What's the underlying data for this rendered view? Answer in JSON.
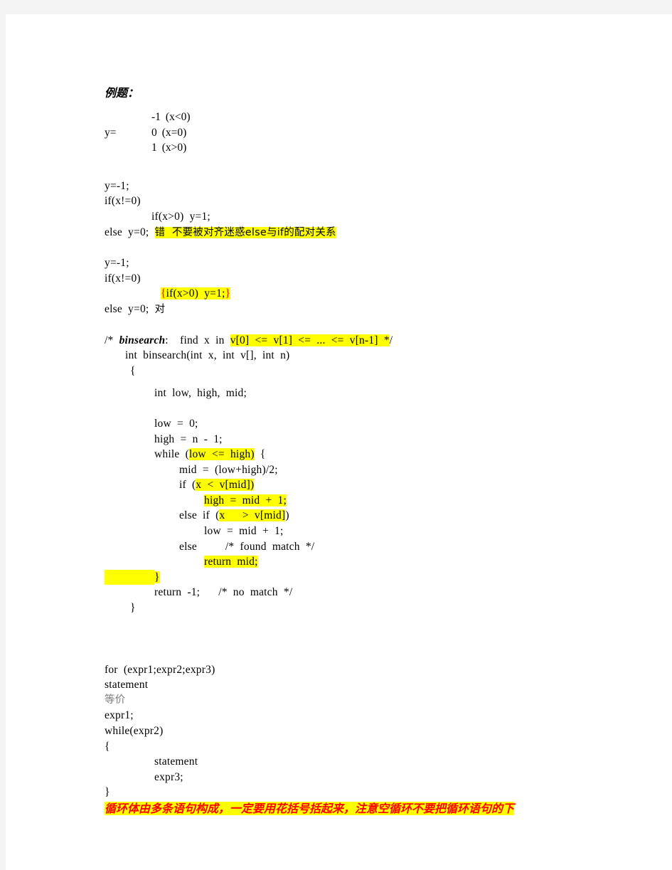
{
  "document": {
    "heading": "例题：",
    "equation": {
      "lhs": "y=",
      "rows": [
        {
          "value": "-1",
          "condition": "(x<0)"
        },
        {
          "value": "0",
          "condition": "(x=0)"
        },
        {
          "value": "1",
          "condition": "(x>0)"
        }
      ]
    },
    "snippet_wrong": {
      "line1": "y=-1;",
      "line2": "if(x!=0)",
      "line3": "if(x>0)  y=1;",
      "line4_code": "else  y=0;  ",
      "line4_note": "错  不要被对齐迷惑else与if的配对关系"
    },
    "snippet_right": {
      "line1": "y=-1;",
      "line2": "if(x!=0)",
      "line3_open": "{",
      "line3_mid": "if(x>0)  y=1;",
      "line3_close": "}",
      "line4_code": "else  y=0;  ",
      "line4_note": "对"
    },
    "binsearch": {
      "comment_prefix": "/*  ",
      "comment_name": "binsearch",
      "comment_mid": ":    find  x  in  ",
      "comment_hl": "v[0]  <=  v[1]  <=  ...  <=  v[n-1]  *",
      "comment_tail": "/",
      "signature": "int  binsearch(int  x,  int  v[],  int  n)",
      "open_brace": "{",
      "decl": "int  low,  high,  mid;",
      "low_init": "low  =  0;",
      "high_init": "high  =  n  -  1;",
      "while_prefix": "while  (",
      "while_hl": "low  <=  high)",
      "while_suffix": "  {",
      "mid_calc": "mid  =  (low+high)/2;",
      "if_prefix": "if  (",
      "if_hl": "x  <  v[mid])",
      "high_assign": "high  =  mid  +  1;",
      "elseif_prefix": "else  if  (",
      "elseif_hl": "x      >  v[mid]",
      "elseif_suffix": ")",
      "low_assign": "low  =  mid  +  1;",
      "else_kw": "else",
      "else_comment": "/*  found  match  */",
      "return_mid": "return  mid;",
      "close_while_brace": "}",
      "return_neg": "return  -1;",
      "return_neg_comment": "/*  no  match  */",
      "close_func_brace": "}"
    },
    "forloop": {
      "line1": "for  (expr1;expr2;expr3)",
      "line2": "statement",
      "equivalent": "等价",
      "line3": "expr1;",
      "line4": "while(expr2)",
      "line5": "{",
      "line6": "statement",
      "line7": "expr3;",
      "line8": "}",
      "note": "循环体由多条语句构成，一定要用花括号括起来，注意空循环不要把循环语句的下"
    }
  },
  "colors": {
    "highlight": "#ffff00",
    "red": "#ff0000",
    "text": "#000000",
    "page": "#ffffff",
    "canvas": "#f4f4f4",
    "gray_text": "#7d7d7d"
  }
}
